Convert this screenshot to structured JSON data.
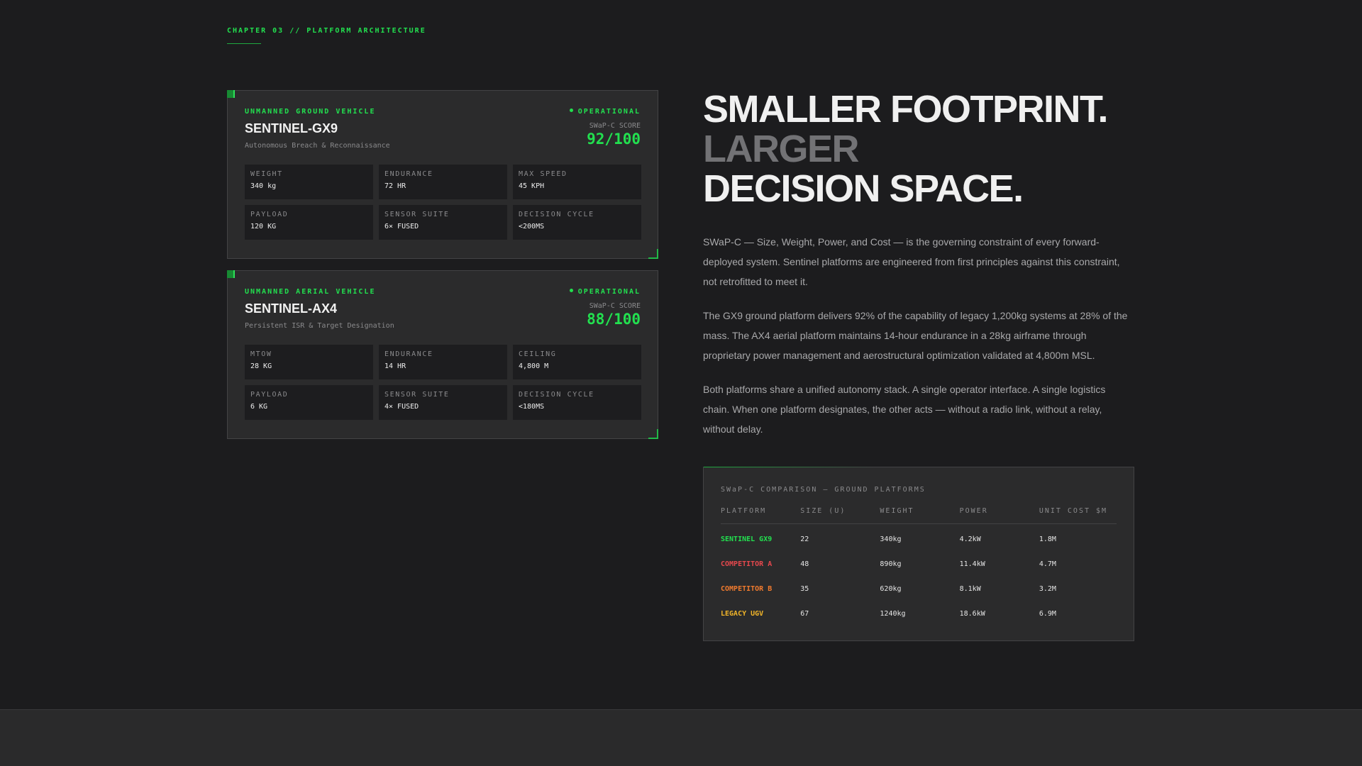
{
  "chapter": "CHAPTER 03 // PLATFORM ARCHITECTURE",
  "vehicles": [
    {
      "type": "UNMANNED GROUND VEHICLE",
      "status": "OPERATIONAL",
      "name": "SENTINEL-GX9",
      "description": "Autonomous Breach & Reconnaissance",
      "score_label": "SWaP-C SCORE",
      "score": "92/100",
      "specs": [
        {
          "label": "WEIGHT",
          "value": "340 kg"
        },
        {
          "label": "ENDURANCE",
          "value": "72 HR"
        },
        {
          "label": "MAX SPEED",
          "value": "45 KPH"
        },
        {
          "label": "PAYLOAD",
          "value": "120 KG"
        },
        {
          "label": "SENSOR SUITE",
          "value": "6× FUSED"
        },
        {
          "label": "DECISION CYCLE",
          "value": "<200MS"
        }
      ]
    },
    {
      "type": "UNMANNED AERIAL VEHICLE",
      "status": "OPERATIONAL",
      "name": "SENTINEL-AX4",
      "description": "Persistent ISR & Target Designation",
      "score_label": "SWaP-C SCORE",
      "score": "88/100",
      "specs": [
        {
          "label": "MTOW",
          "value": "28 KG"
        },
        {
          "label": "ENDURANCE",
          "value": "14 HR"
        },
        {
          "label": "CEILING",
          "value": "4,800 M"
        },
        {
          "label": "PAYLOAD",
          "value": "6 KG"
        },
        {
          "label": "SENSOR SUITE",
          "value": "4× FUSED"
        },
        {
          "label": "DECISION CYCLE",
          "value": "<180MS"
        }
      ]
    }
  ],
  "headline": {
    "line1": "SMALLER FOOTPRINT.",
    "line2": "LARGER",
    "line3": "DECISION SPACE."
  },
  "paragraphs": [
    "SWaP-C — Size, Weight, Power, and Cost — is the governing constraint of every forward-deployed system. Sentinel platforms are engineered from first principles against this constraint, not retrofitted to meet it.",
    "The GX9 ground platform delivers 92% of the capability of legacy 1,200kg systems at 28% of the mass. The AX4 aerial platform maintains 14-hour endurance in a 28kg airframe through proprietary power management and aerostructural optimization validated at 4,800m MSL.",
    "Both platforms share a unified autonomy stack. A single operator interface. A single logistics chain. When one platform designates, the other acts — without a radio link, without a relay, without delay."
  ],
  "comparison": {
    "title": "SWaP-C COMPARISON — GROUND PLATFORMS",
    "headers": [
      "PLATFORM",
      "SIZE (U)",
      "WEIGHT",
      "POWER",
      "UNIT COST $M"
    ],
    "rows": [
      {
        "platform": "SENTINEL GX9",
        "size": "22",
        "weight": "340kg",
        "power": "4.2kW",
        "cost": "1.8M",
        "color": "#22e04f"
      },
      {
        "platform": "COMPETITOR A",
        "size": "48",
        "weight": "890kg",
        "power": "11.4kW",
        "cost": "4.7M",
        "color": "#e5484d"
      },
      {
        "platform": "COMPETITOR B",
        "size": "35",
        "weight": "620kg",
        "power": "8.1kW",
        "cost": "3.2M",
        "color": "#f07a2e"
      },
      {
        "platform": "LEGACY UGV",
        "size": "67",
        "weight": "1240kg",
        "power": "18.6kW",
        "cost": "6.9M",
        "color": "#f0b429"
      }
    ]
  },
  "colors": {
    "accent": "#22e04f",
    "background": "#1c1c1e",
    "card": "#2b2b2c"
  }
}
